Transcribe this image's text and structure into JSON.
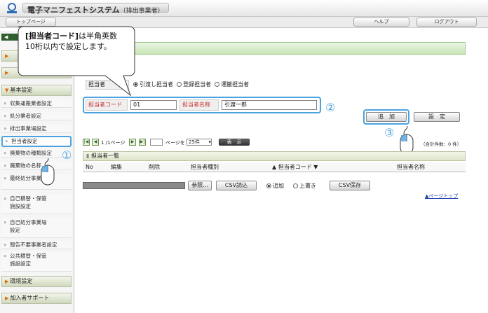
{
  "header": {
    "app_title": "電子マニフェストシステム",
    "app_subtitle": "（排出事業者）"
  },
  "menubar": {
    "top_page": "トップページ",
    "help": "ヘルプ",
    "logout": "ログアウト"
  },
  "sidebar": {
    "section_basic": "基本設定",
    "items": [
      "収集運搬業者設定",
      "処分業者設定",
      "排出事業場設定",
      "担当者設定",
      "廃棄物の種類設定",
      "廃棄物の名称",
      "最終処分事業",
      "自己積替・保管施設設定",
      "自己処分事業場設定",
      "報告不要事業者設定",
      "公共積替・保管施設設定"
    ],
    "section_env": "環境設定",
    "section_support": "加入者サポート"
  },
  "callout": {
    "text_bold": "[担当者コード]",
    "text_rest": "は半角英数10桁以内で設定します。"
  },
  "criteria": {
    "type_label": "担当者",
    "radio_options": [
      "引渡し担当者",
      "登録担当者",
      "運搬担当者"
    ],
    "code_label": "担当者コード",
    "code_value": "01",
    "name_label": "担当者名称",
    "name_value": "引渡一郎",
    "add_button": "追　加",
    "set_button": "設　定"
  },
  "pager": {
    "page_info": "1 /1ページ",
    "page_to": "ページを",
    "page_size": "25件",
    "show_button": "表　示",
    "total": "（合計件数：0 件）"
  },
  "list": {
    "title": "担当者一覧",
    "columns": [
      "No",
      "編集",
      "削除",
      "担当者種別",
      "▲ 担当者コード ▼",
      "担当者名称"
    ]
  },
  "csv": {
    "browse": "参照...",
    "read": "CSV読込",
    "mode_add": "追加",
    "mode_overwrite": "上書き",
    "save": "CSV保存"
  },
  "page_top": "ページトップ",
  "steps": [
    "①",
    "②",
    "③"
  ]
}
